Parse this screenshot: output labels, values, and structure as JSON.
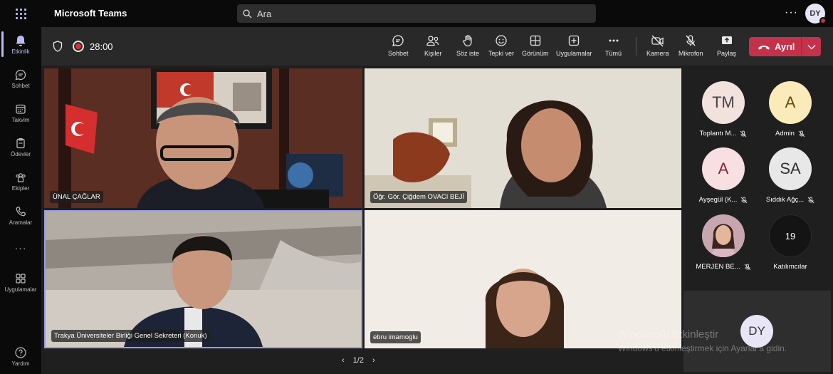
{
  "app": {
    "title": "Microsoft Teams"
  },
  "search": {
    "placeholder": "Ara"
  },
  "user": {
    "initials": "DY"
  },
  "rail": {
    "items": [
      {
        "label": "Etkinlik",
        "icon": "bell-icon",
        "active": true
      },
      {
        "label": "Sohbet",
        "icon": "chat-icon"
      },
      {
        "label": "Takvim",
        "icon": "calendar-icon"
      },
      {
        "label": "Ödevler",
        "icon": "assignments-icon"
      },
      {
        "label": "Ekipler",
        "icon": "teams-icon"
      },
      {
        "label": "Aramalar",
        "icon": "phone-icon"
      },
      {
        "label": "Uygulamalar",
        "icon": "apps-icon"
      },
      {
        "label": "Yardım",
        "icon": "help-icon"
      }
    ],
    "more": "···"
  },
  "meeting": {
    "timer": "28:00",
    "controls": {
      "chat": "Sohbet",
      "people": "Kişiler",
      "raise": "Söz iste",
      "react": "Tepki ver",
      "view": "Görünüm",
      "apps": "Uygulamalar",
      "more": "Tümü",
      "camera": "Kamera",
      "mic": "Mikrofon",
      "share": "Paylaş"
    },
    "leave": "Ayrıl"
  },
  "tiles": [
    {
      "name": "ÜNAL ÇAĞLAR"
    },
    {
      "name": "Öğr. Gör. Çiğdem OVACI BEJİ"
    },
    {
      "name": "Trakya Üniversiteler Birliği Genel Sekreteri (Konuk)"
    },
    {
      "name": "ebru imamoglu"
    }
  ],
  "pager": {
    "label": "1/2"
  },
  "roster": [
    {
      "initials": "TM",
      "name": "Toplantı M...",
      "bg": "#f1e2de"
    },
    {
      "initials": "A",
      "name": "Admin",
      "bg": "#fbeaba"
    },
    {
      "initials": "A",
      "name": "Ayşegül (K...",
      "bg": "#f8dfe2"
    },
    {
      "initials": "SA",
      "name": "Sıddık Ağç...",
      "bg": "#e8e8e8"
    },
    {
      "initials": "",
      "name": "MERJEN BE...",
      "bg": "#8a6a70"
    },
    {
      "initials": "19",
      "name": "Katılımcılar",
      "bg": "#141414"
    }
  ],
  "self": {
    "initials": "DY"
  },
  "watermark": {
    "line1": "Windows'u Etkinleştir",
    "line2": "Windows'u etkinleştirmek için Ayarlar'a gidin."
  },
  "colors": {
    "accent": "#b9b9f3",
    "leave": "#c4314b"
  }
}
